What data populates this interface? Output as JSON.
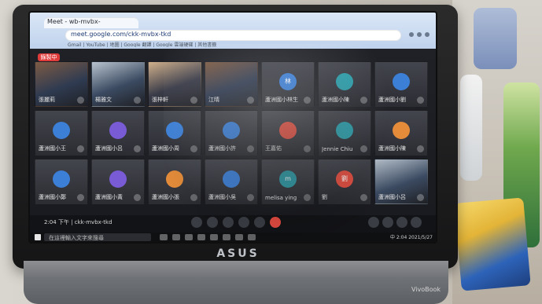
{
  "browser": {
    "tab_title": "Meet - wb-mvbx-",
    "url": "meet.google.com/ckk-mvbx-tkd",
    "bookmarks": "Gmail | YouTube | 地圖 | Google 翻譯 | Google 雲端硬碟 | 其他書籤"
  },
  "meet": {
    "recording_badge": "錄製中",
    "clock_text": "2:04 下午 | ckk-mvbx-tkd",
    "tiles": [
      {
        "name": "張麗莉",
        "avatar": "",
        "kind": "photo"
      },
      {
        "name": "楊雅文",
        "avatar": "",
        "kind": "photo2"
      },
      {
        "name": "張梓軒",
        "avatar": "",
        "kind": "photo3"
      },
      {
        "name": "江晴",
        "avatar": "",
        "kind": "photo"
      },
      {
        "name": "蘆洲國小林生",
        "avatar": "林",
        "kind": "avatar",
        "color": "blue"
      },
      {
        "name": "蘆洲國小陳",
        "avatar": "",
        "kind": "avatar",
        "color": "teal"
      },
      {
        "name": "蘆洲國小劉",
        "avatar": "",
        "kind": "avatar",
        "color": "blue"
      },
      {
        "name": "蘆洲國小王",
        "avatar": "",
        "kind": "avatar",
        "color": "blue"
      },
      {
        "name": "蘆洲國小呂",
        "avatar": "",
        "kind": "avatar",
        "color": "purple"
      },
      {
        "name": "蘆洲國小周",
        "avatar": "",
        "kind": "avatar",
        "color": "blue"
      },
      {
        "name": "蘆洲國小許",
        "avatar": "",
        "kind": "avatar",
        "color": "blue"
      },
      {
        "name": "王嘉佑",
        "avatar": "",
        "kind": "avatar",
        "color": "red"
      },
      {
        "name": "Jennie Chiu",
        "avatar": "",
        "kind": "avatar",
        "color": "teal"
      },
      {
        "name": "蘆洲國小陳",
        "avatar": "",
        "kind": "avatar",
        "color": "orange"
      },
      {
        "name": "蘆洲國小鄭",
        "avatar": "",
        "kind": "avatar",
        "color": "blue"
      },
      {
        "name": "蘆洲國小黃",
        "avatar": "",
        "kind": "avatar",
        "color": "purple"
      },
      {
        "name": "蘆洲國小張",
        "avatar": "",
        "kind": "avatar",
        "color": "orange"
      },
      {
        "name": "蘆洲國小吳",
        "avatar": "",
        "kind": "avatar",
        "color": "blue"
      },
      {
        "name": "melisa ying",
        "avatar": "m",
        "kind": "avatar",
        "color": "teal"
      },
      {
        "name": "劉",
        "avatar": "劉",
        "kind": "avatar",
        "color": "red"
      },
      {
        "name": "蘆洲國小呂",
        "avatar": "",
        "kind": "photo2"
      }
    ]
  },
  "taskbar": {
    "search_placeholder": "在這裡輸入文字來搜尋",
    "system_tray": "中 2:04 2021/5/27"
  },
  "laptop": {
    "brand": "ASUS",
    "model": "VivoBook"
  },
  "colors": {
    "accent_red": "#e34b40",
    "browser_blue": "#cfe0f5"
  },
  "icons": {
    "mic": "mic-icon",
    "camera": "camera-icon",
    "present": "present-icon",
    "more": "more-icon",
    "hangup": "hangup-icon",
    "info": "info-icon",
    "people": "people-icon",
    "chat": "chat-icon",
    "activities": "activities-icon"
  }
}
